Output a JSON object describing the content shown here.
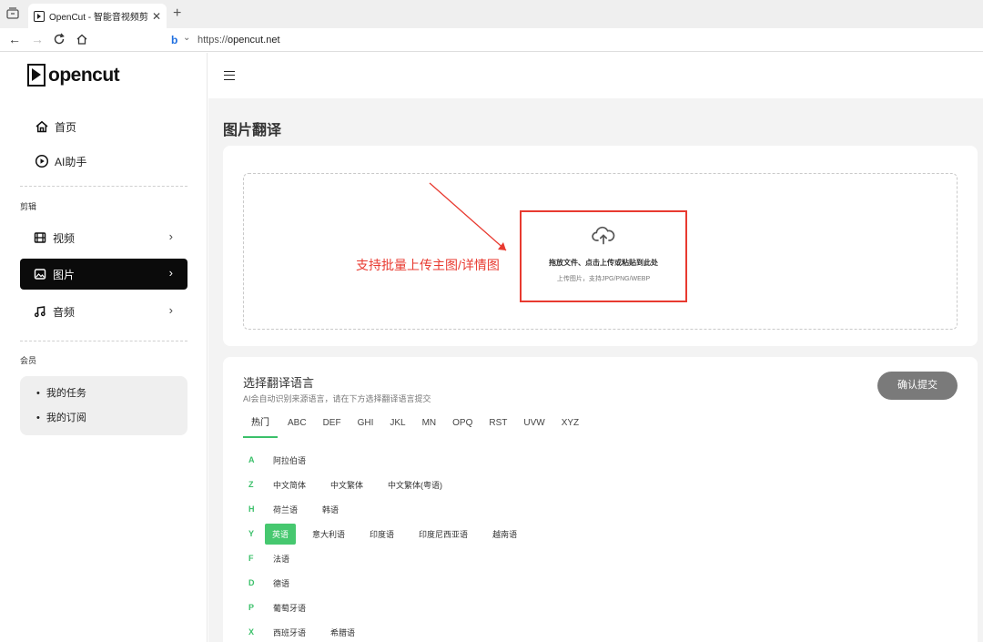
{
  "browser": {
    "tab_title": "OpenCut - 智能音视频剪辑工具",
    "tab_close": "✕",
    "new_tab": "+",
    "url_scheme": "https://",
    "url_host": "opencut.net"
  },
  "sidebar": {
    "logo_text": "opencut",
    "top_items": [
      {
        "label": "首页",
        "icon": "home-icon"
      },
      {
        "label": "AI助手",
        "icon": "play-circle-icon"
      }
    ],
    "section_edit": "剪辑",
    "edit_items": [
      {
        "label": "视频",
        "icon": "film-icon"
      },
      {
        "label": "图片",
        "icon": "image-icon",
        "active": true
      },
      {
        "label": "音频",
        "icon": "music-icon"
      }
    ],
    "section_member": "会员",
    "member_items": [
      "我的任务",
      "我的订阅"
    ]
  },
  "main": {
    "page_title": "图片翻译",
    "upload": {
      "main_text": "拖放文件、点击上传或粘贴到此处",
      "sub_text": "上传图片，支持JPG/PNG/WEBP",
      "annotation": "支持批量上传主图/详情图",
      "annotation_color": "#e83a30"
    },
    "lang": {
      "title": "选择翻译语言",
      "subtitle": "AI会自动识别来源语言，请在下方选择翻译语言提交",
      "submit_label": "确认提交",
      "tabs": [
        "热门",
        "ABC",
        "DEF",
        "GHI",
        "JKL",
        "MN",
        "OPQ",
        "RST",
        "UVW",
        "XYZ"
      ],
      "active_tab": "热门",
      "rows": [
        {
          "letter": "A",
          "langs": [
            "阿拉伯语"
          ]
        },
        {
          "letter": "Z",
          "langs": [
            "中文简体",
            "中文繁体",
            "中文繁体(粤语)"
          ]
        },
        {
          "letter": "H",
          "langs": [
            "荷兰语",
            "韩语"
          ]
        },
        {
          "letter": "Y",
          "langs": [
            "英语",
            "意大利语",
            "印度语",
            "印度尼西亚语",
            "越南语"
          ],
          "selected": "英语"
        },
        {
          "letter": "F",
          "langs": [
            "法语"
          ]
        },
        {
          "letter": "D",
          "langs": [
            "德语"
          ]
        },
        {
          "letter": "P",
          "langs": [
            "葡萄牙语"
          ]
        },
        {
          "letter": "X",
          "langs": [
            "西班牙语",
            "希腊语"
          ]
        }
      ],
      "accent": "#3bc06a"
    }
  }
}
